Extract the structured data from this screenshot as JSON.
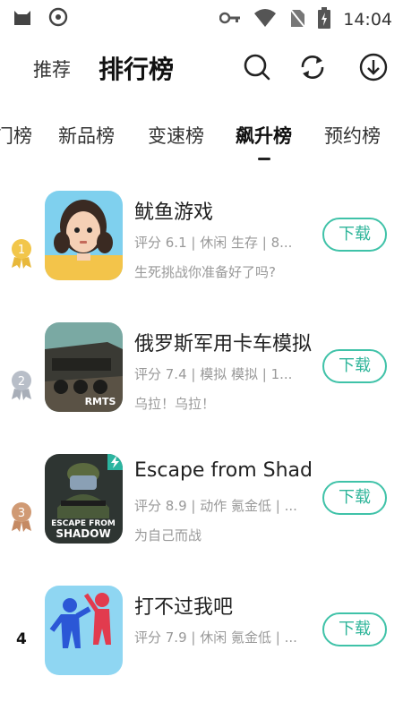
{
  "status_bar": {
    "time": "14:04",
    "icons": [
      "cat-icon",
      "record-icon",
      "key-icon",
      "wifi-icon",
      "no-sim-icon",
      "battery-charging-icon"
    ]
  },
  "header": {
    "recommend": "推荐",
    "title": "排行榜",
    "icons": [
      "search-icon",
      "refresh-icon",
      "download-icon"
    ]
  },
  "tabs": [
    "门榜",
    "新品榜",
    "变速榜",
    "飙升榜",
    "预约榜"
  ],
  "active_tab": "飙升榜",
  "colors": {
    "accent": "#3fc2a8",
    "gold": "#e8b83a",
    "silver": "#a8aeb8",
    "bronze": "#c58a63"
  },
  "apps": [
    {
      "rank": "1",
      "name": "鱿鱼游戏",
      "meta": "评分  6.1  |  休闲 生存  |  8...",
      "desc": "生死挑战你准备好了吗?",
      "button": "下载",
      "icon_text": ""
    },
    {
      "rank": "2",
      "name": "俄罗斯军用卡车模拟",
      "meta": "评分  7.4  |  模拟 模拟  |  1...",
      "desc": "乌拉！乌拉！",
      "button": "下载",
      "icon_text": "RMTS"
    },
    {
      "rank": "3",
      "name": "Escape from Shad...",
      "meta": "评分  8.9  |  动作 氪金低  |  ...",
      "desc": "为自己而战",
      "button": "下载",
      "icon_text": "ESCAPE FROM SHADOW"
    },
    {
      "rank": "4",
      "name": "打不过我吧",
      "meta": "评分  7.9  |  休闲 氪金低  |  ...",
      "desc": "",
      "button": "下载",
      "icon_text": ""
    }
  ]
}
